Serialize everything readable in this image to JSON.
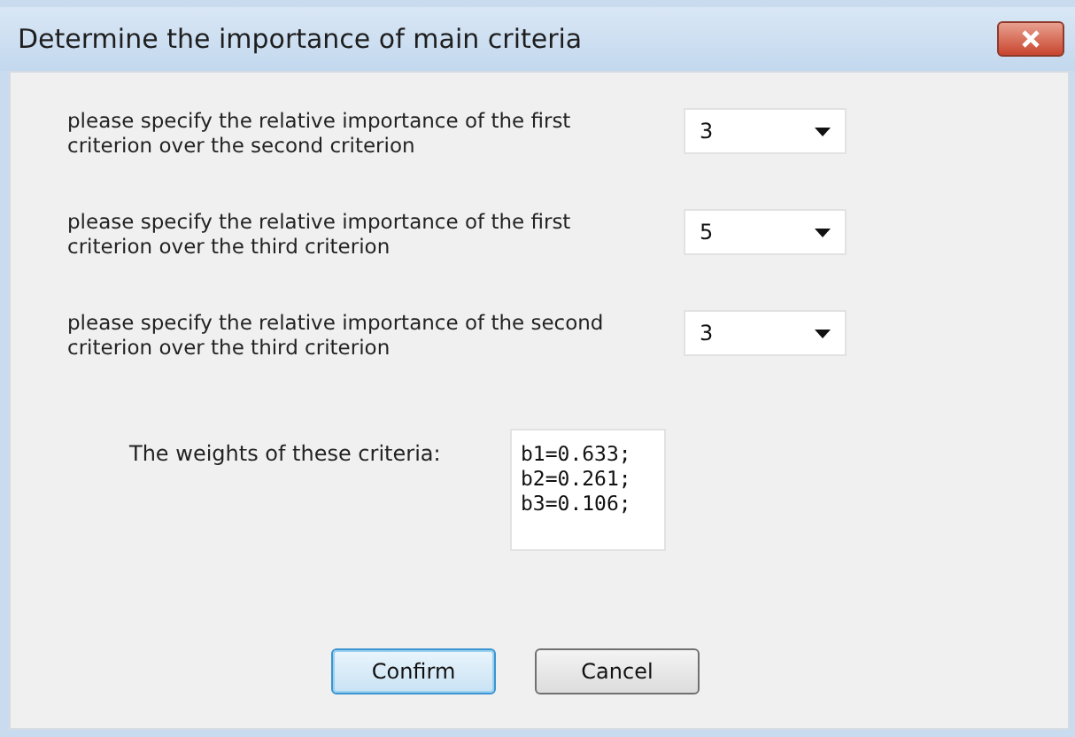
{
  "window": {
    "title": "Determine the importance of main criteria"
  },
  "comparisons": [
    {
      "label": "please specify the relative importance of the first criterion over the second criterion",
      "value": "3"
    },
    {
      "label": "please specify the relative importance of the first criterion over the third criterion",
      "value": "5"
    },
    {
      "label": "please specify the relative importance of the second criterion over the third criterion",
      "value": "3"
    }
  ],
  "weights": {
    "label": "The weights of these criteria:",
    "lines": [
      "b1=0.633;",
      "b2=0.261;",
      "b3=0.106;"
    ]
  },
  "buttons": [
    {
      "label": "Confirm",
      "default": true
    },
    {
      "label": "Cancel",
      "default": false
    }
  ]
}
